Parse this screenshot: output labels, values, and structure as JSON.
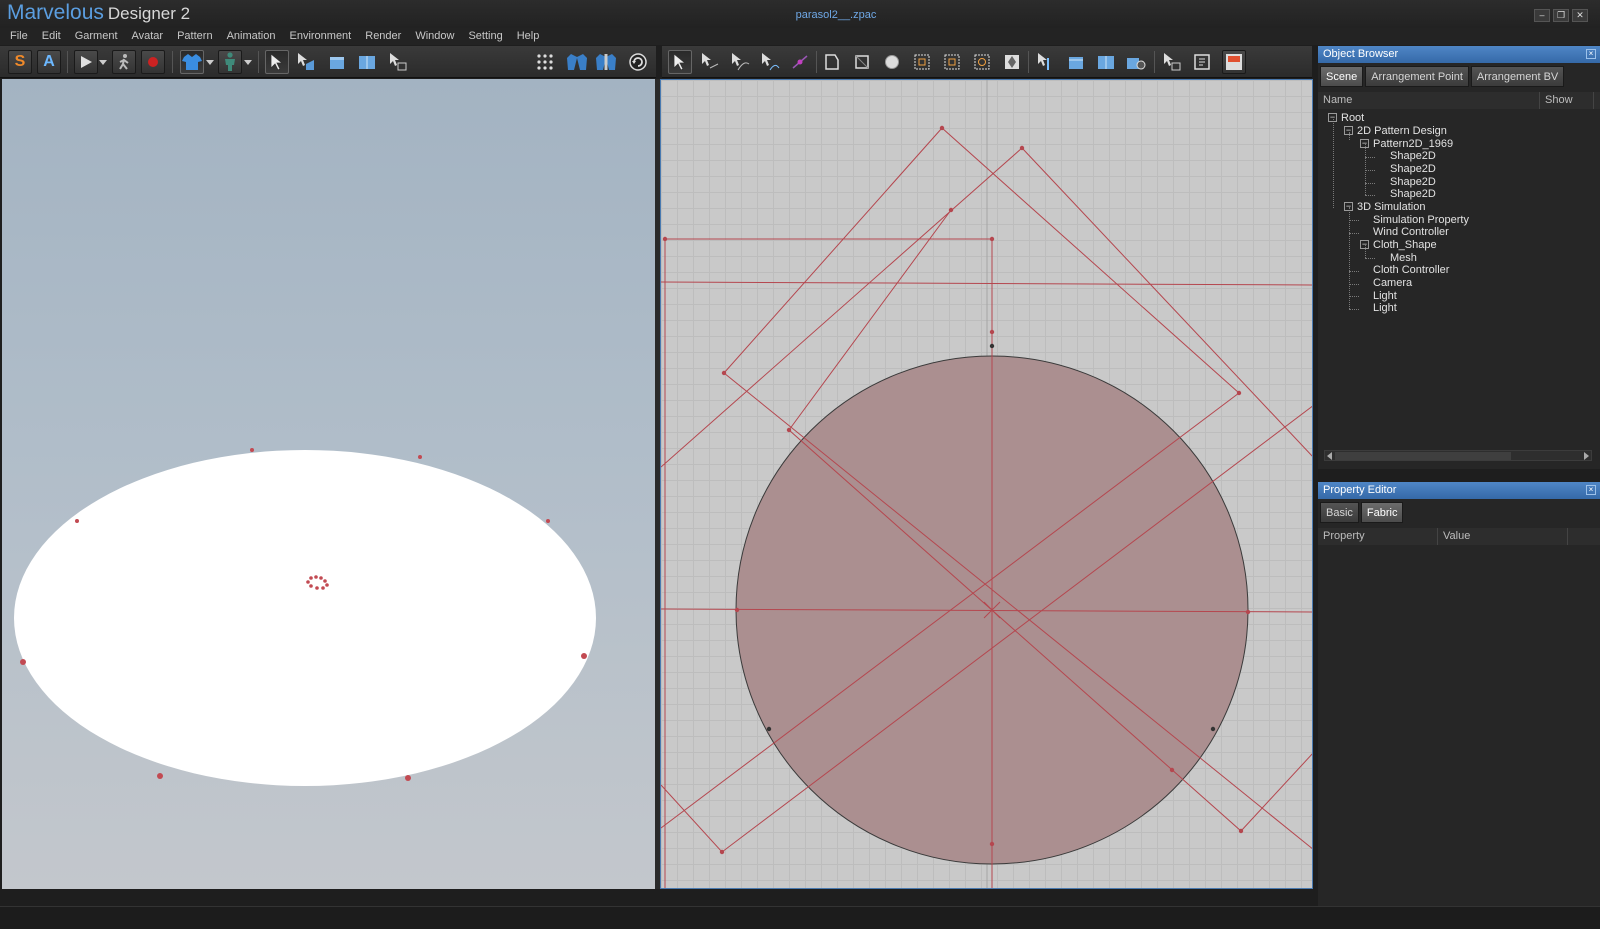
{
  "app": {
    "brand_primary": "Marvelous",
    "brand_secondary": "Designer 2",
    "document_title": "parasol2__.zpac",
    "window_buttons": [
      "–",
      "❐",
      "✕"
    ]
  },
  "menu": [
    "File",
    "Edit",
    "Garment",
    "Avatar",
    "Pattern",
    "Animation",
    "Environment",
    "Render",
    "Window",
    "Setting",
    "Help"
  ],
  "toolbar_left": {
    "mode_buttons": [
      "S",
      "A"
    ]
  },
  "object_browser": {
    "title": "Object Browser",
    "tabs": [
      "Scene",
      "Arrangement Point",
      "Arrangement BV"
    ],
    "active_tab": "Scene",
    "columns": [
      "Name",
      "Show"
    ],
    "tree": [
      {
        "label": "Root"
      },
      {
        "label": "2D Pattern Design"
      },
      {
        "label": "Pattern2D_1969"
      },
      {
        "label": "Shape2D"
      },
      {
        "label": "Shape2D"
      },
      {
        "label": "Shape2D"
      },
      {
        "label": "Shape2D"
      },
      {
        "label": "3D Simulation"
      },
      {
        "label": "Simulation Property"
      },
      {
        "label": "Wind Controller"
      },
      {
        "label": "Cloth_Shape"
      },
      {
        "label": "Mesh"
      },
      {
        "label": "Cloth Controller"
      },
      {
        "label": "Camera"
      },
      {
        "label": "Light"
      },
      {
        "label": "Light"
      }
    ]
  },
  "property_editor": {
    "title": "Property Editor",
    "tabs": [
      "Basic",
      "Fabric"
    ],
    "active_tab": "Fabric",
    "columns": [
      "Property",
      "Value"
    ]
  },
  "colors": {
    "accent": "#4f86c6",
    "pattern_line": "#b5474f",
    "pattern_fill": "#ab8f90",
    "doc_title": "#6fa8e6"
  }
}
